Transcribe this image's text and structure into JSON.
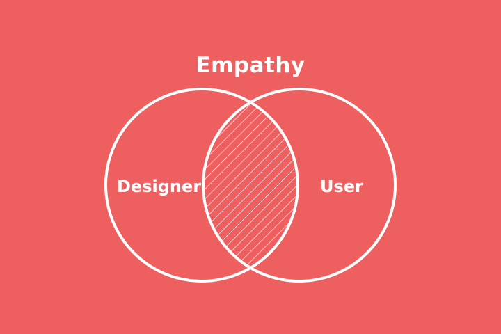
{
  "diagram": {
    "title": "Empathy",
    "left_circle_label": "Designer",
    "right_circle_label": "User"
  },
  "colors": {
    "background": "#ee5f5f",
    "stroke": "#ffffff"
  }
}
